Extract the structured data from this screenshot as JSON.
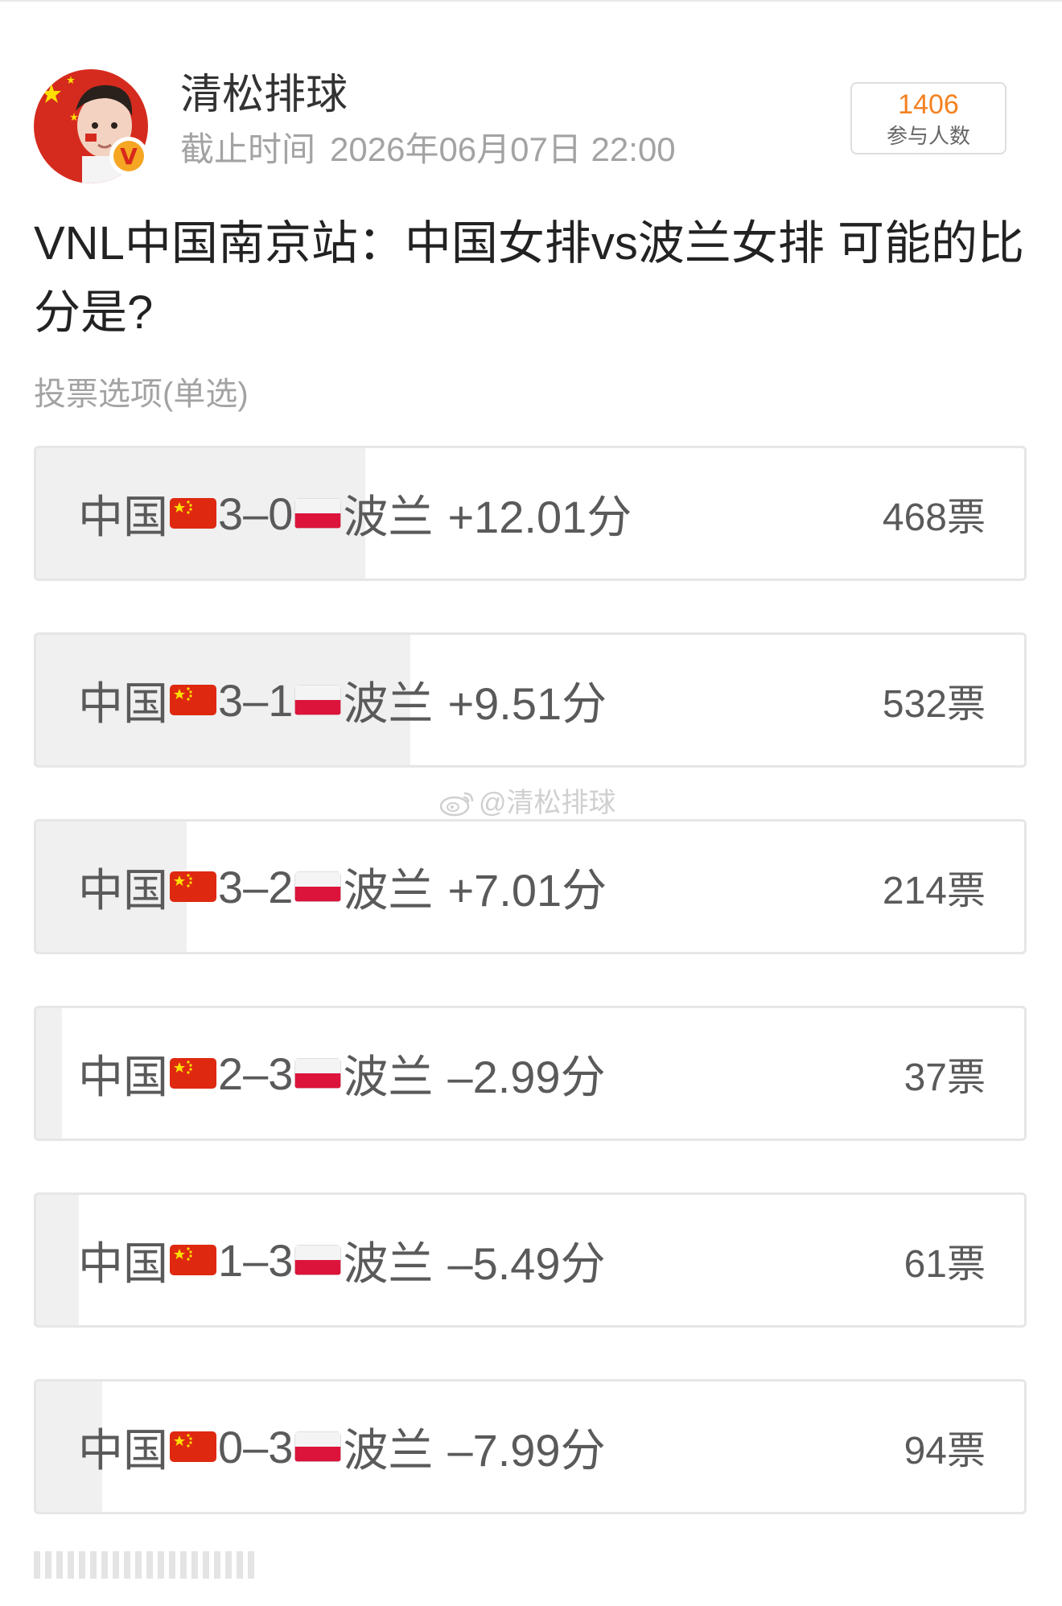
{
  "header": {
    "username": "清松排球",
    "deadline_label": "截止时间",
    "deadline_value": "2026年06月07日 22:00",
    "participants_count": "1406",
    "participants_label": "参与人数",
    "verified_badge": "V"
  },
  "poll": {
    "question": "VNL中国南京站：中国女排vs波兰女排 可能的比分是?",
    "vote_type": "投票选项(单选)",
    "total_votes": 1406,
    "options": [
      {
        "team_a": "中国",
        "score": "3–0",
        "team_b": "波兰",
        "points": "+12.01分",
        "votes_label": "468票",
        "votes": 468
      },
      {
        "team_a": "中国",
        "score": "3–1",
        "team_b": "波兰",
        "points": "+9.51分",
        "votes_label": "532票",
        "votes": 532
      },
      {
        "team_a": "中国",
        "score": "3–2",
        "team_b": "波兰",
        "points": "+7.01分",
        "votes_label": "214票",
        "votes": 214
      },
      {
        "team_a": "中国",
        "score": "2–3",
        "team_b": "波兰",
        "points": "–2.99分",
        "votes_label": "37票",
        "votes": 37
      },
      {
        "team_a": "中国",
        "score": "1–3",
        "team_b": "波兰",
        "points": "–5.49分",
        "votes_label": "61票",
        "votes": 61
      },
      {
        "team_a": "中国",
        "score": "0–3",
        "team_b": "波兰",
        "points": "–7.99分",
        "votes_label": "94票",
        "votes": 94
      }
    ]
  },
  "watermark": "@清松排球",
  "icons": {
    "china_flag": "china-flag-icon",
    "poland_flag": "poland-flag-icon",
    "weibo": "weibo-icon",
    "verified": "verified-badge-icon"
  },
  "colors": {
    "participants_count": "#f48120",
    "secondary_text": "#a3a3a3",
    "option_fill": "#f0f0f0",
    "option_border": "#e6e6e6",
    "verified_badge": "#f5a623"
  }
}
